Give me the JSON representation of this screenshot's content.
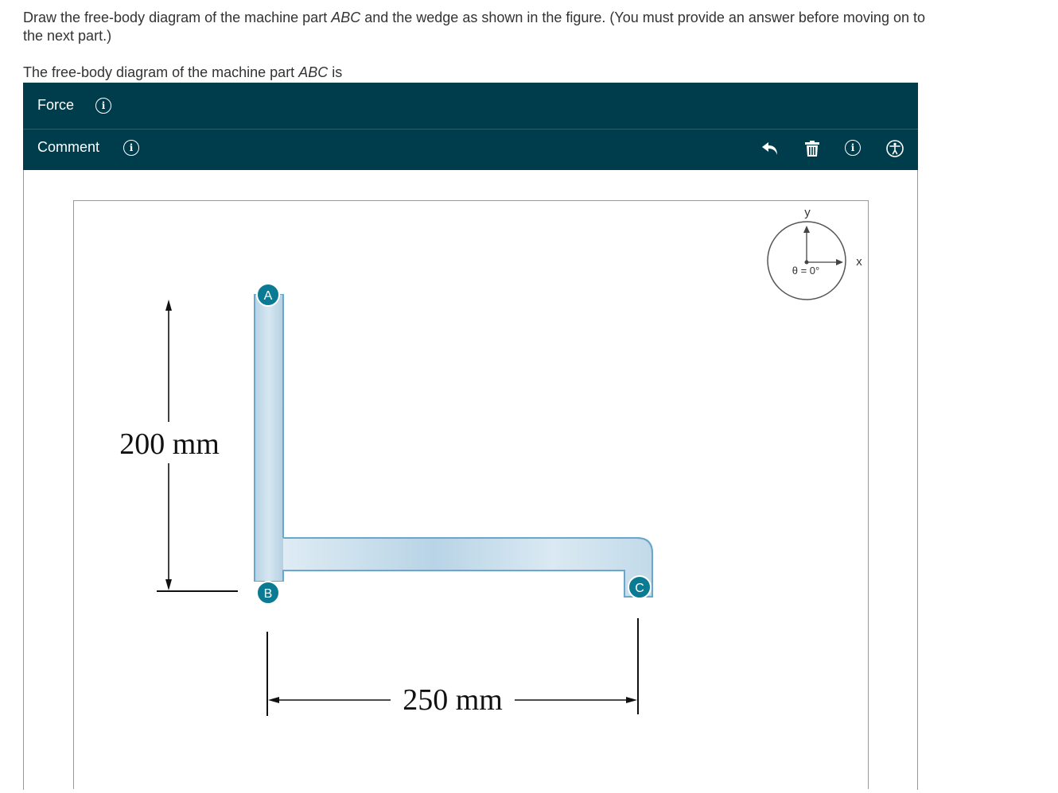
{
  "question": {
    "prefix": "Draw the free-body diagram of the machine part ",
    "part": "ABC",
    "suffix": " and the wedge as shown in the figure. (You must provide an answer before moving on to the next part.)"
  },
  "sub_prompt": {
    "prefix": "The free-body diagram of the machine part ",
    "part": "ABC",
    "suffix": " is"
  },
  "toolbar": {
    "force_label": "Force",
    "comment_label": "Comment",
    "info_glyph": "i",
    "icons": [
      "undo-icon",
      "trash-icon",
      "info-icon",
      "accessibility-icon"
    ]
  },
  "axes_indicator": {
    "y_label": "y",
    "x_label": "x",
    "angle_text": "θ = 0°"
  },
  "figure": {
    "point_a": "A",
    "point_b": "B",
    "point_c": "C",
    "height_dim": "200 mm",
    "width_dim": "250 mm"
  },
  "colors": {
    "panel": "#003d4c",
    "point_badge": "#0b7a93",
    "part_fill": "#c5dce9",
    "part_edge": "#5b9fc6"
  }
}
